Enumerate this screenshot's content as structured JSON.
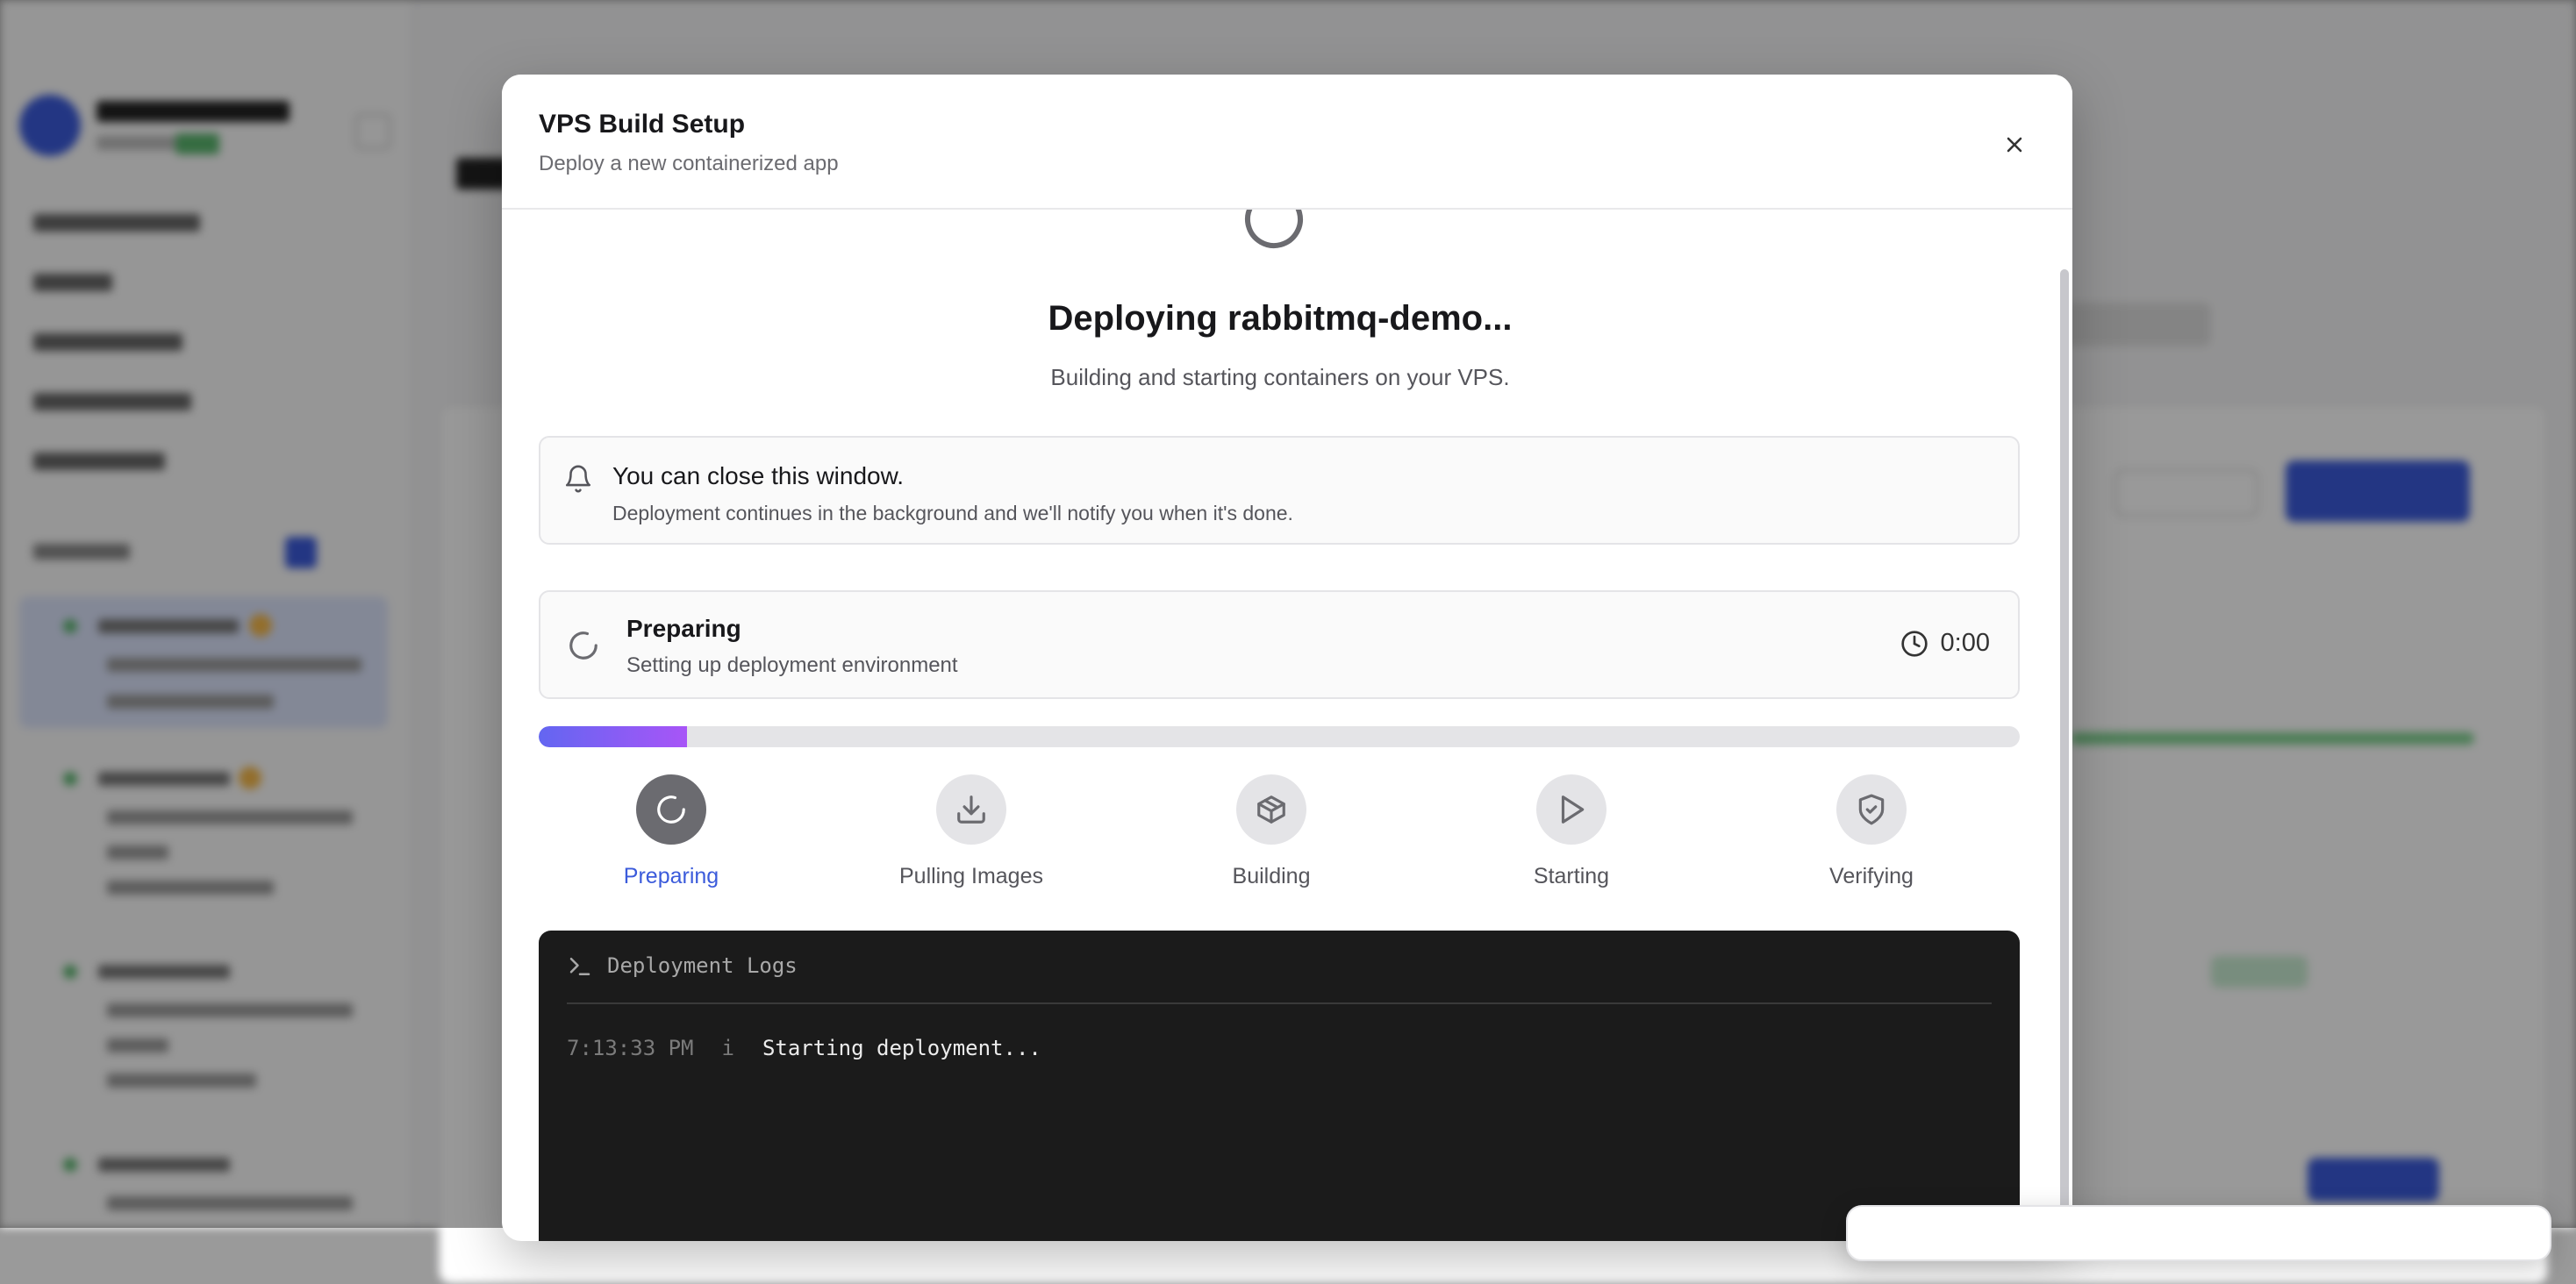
{
  "modal": {
    "title": "VPS Build Setup",
    "subtitle": "Deploy a new containerized app"
  },
  "deploy": {
    "title": "Deploying rabbitmq-demo...",
    "subtitle": "Building and starting containers on your VPS."
  },
  "notice": {
    "title": "You can close this window.",
    "body": "Deployment continues in the background and we'll notify you when it's done.",
    "icon": "bell-icon"
  },
  "stage": {
    "title": "Preparing",
    "description": "Setting up deployment environment",
    "elapsed": "0:00",
    "icon": "spinner-icon"
  },
  "progress": {
    "percent": 10
  },
  "steps": [
    {
      "label": "Preparing",
      "icon": "spinner-icon",
      "state": "active"
    },
    {
      "label": "Pulling Images",
      "icon": "download-icon",
      "state": "pending"
    },
    {
      "label": "Building",
      "icon": "package-icon",
      "state": "pending"
    },
    {
      "label": "Starting",
      "icon": "play-icon",
      "state": "pending"
    },
    {
      "label": "Verifying",
      "icon": "shield-check-icon",
      "state": "pending"
    }
  ],
  "logs": {
    "title": "Deployment Logs",
    "entries": [
      {
        "time": "7:13:33 PM",
        "level": "i",
        "message": "Starting deployment..."
      }
    ]
  },
  "colors": {
    "accent": "#3b5bdb",
    "progress_start": "#6366f1",
    "progress_end": "#a855f7",
    "log_background": "#1b1b1b"
  }
}
